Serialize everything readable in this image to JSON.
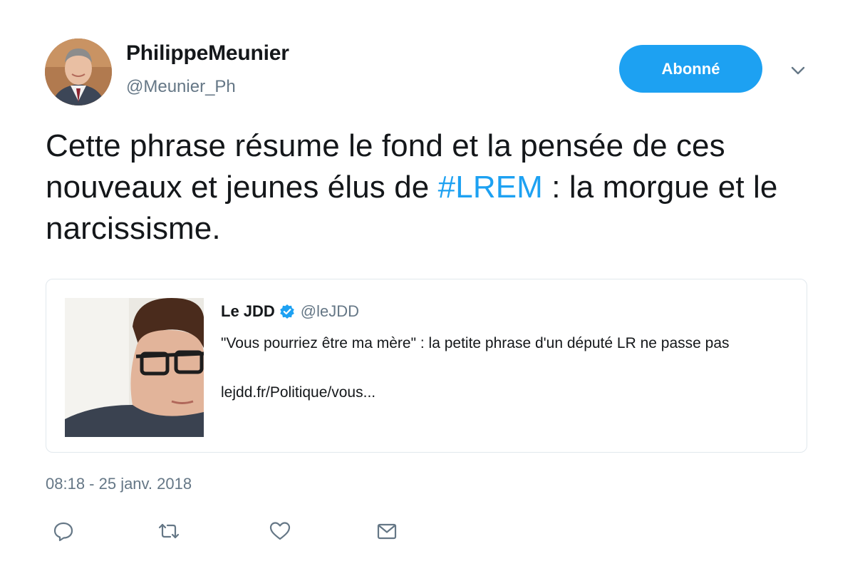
{
  "author": {
    "display_name": "PhilippeMeunier",
    "handle": "@Meunier_Ph",
    "avatar_icon": "profile-photo"
  },
  "follow_button": {
    "label": "Abonné",
    "color": "#1da1f2"
  },
  "menu": {
    "icon": "chevron-down-icon"
  },
  "tweet": {
    "text_part1": "Cette phrase résume le fond et la pensée de ces nouveaux et jeunes élus de ",
    "hashtag": "#LREM",
    "text_part2": " : la morgue et le narcissisme."
  },
  "card": {
    "name": "Le JDD",
    "verified_icon": "verified-badge-icon",
    "handle": "@leJDD",
    "description": "\"Vous pourriez être ma mère\" : la petite phrase d'un député LR ne passe pas",
    "link": "lejdd.fr/Politique/vous..."
  },
  "timestamp": "08:18 - 25 janv. 2018",
  "actions": [
    "reply-icon",
    "retweet-icon",
    "like-icon",
    "message-icon"
  ],
  "colors": {
    "accent": "#1da1f2",
    "text": "#14171a",
    "muted": "#657786",
    "border": "#e1e8ed"
  }
}
